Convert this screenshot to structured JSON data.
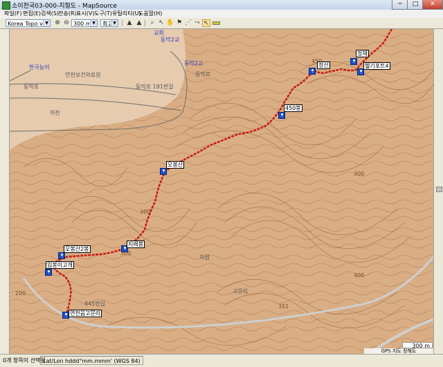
{
  "window": {
    "title": "소이천국03-000-지형도 - MapSource",
    "minimize": "─",
    "maximize": "□",
    "close": "✕"
  },
  "menu": [
    "파일(F)",
    "편집(E)",
    "검색(S)",
    "전송(R)",
    "표시(V)",
    "도구(T)",
    "유틸리티(U)",
    "도움말(H)"
  ],
  "toolbar": {
    "map_product": "Korea Topo v1",
    "zoom_scale": "300 m",
    "detail_level": "최고",
    "zoom_in_icon": "⊕",
    "zoom_out_icon": "⊖"
  },
  "map": {
    "road_labels": [
      "연천보건의료원",
      "동막로",
      "동막로 191번길",
      "동막2교",
      "한국농어",
      "동막로",
      "히천"
    ],
    "top_poi": [
      "교회",
      "동막2교"
    ],
    "places": [
      "지점",
      "고문리"
    ],
    "contours": [
      "450",
      "300",
      "300",
      "300",
      "400",
      "200",
      "351"
    ],
    "road_numbers": [
      "445번길"
    ],
    "waypoints": [
      {
        "name": "정재"
      },
      {
        "name": "정산"
      },
      {
        "name": "헬기포트4"
      },
      {
        "name": "450봉"
      },
      {
        "name": "오봉산"
      },
      {
        "name": "지래봉"
      },
      {
        "name": "오봉산2봉"
      },
      {
        "name": "입봉이고개"
      },
      {
        "name": "연천읍고문리"
      }
    ],
    "scale_label": "300 m",
    "credit": "GPS 지도 정해도"
  },
  "status": {
    "selection": "0개 항목이 선택됨",
    "coords_format": "Lat/Lon hddd°mm.mmm' (WGS 84)"
  }
}
